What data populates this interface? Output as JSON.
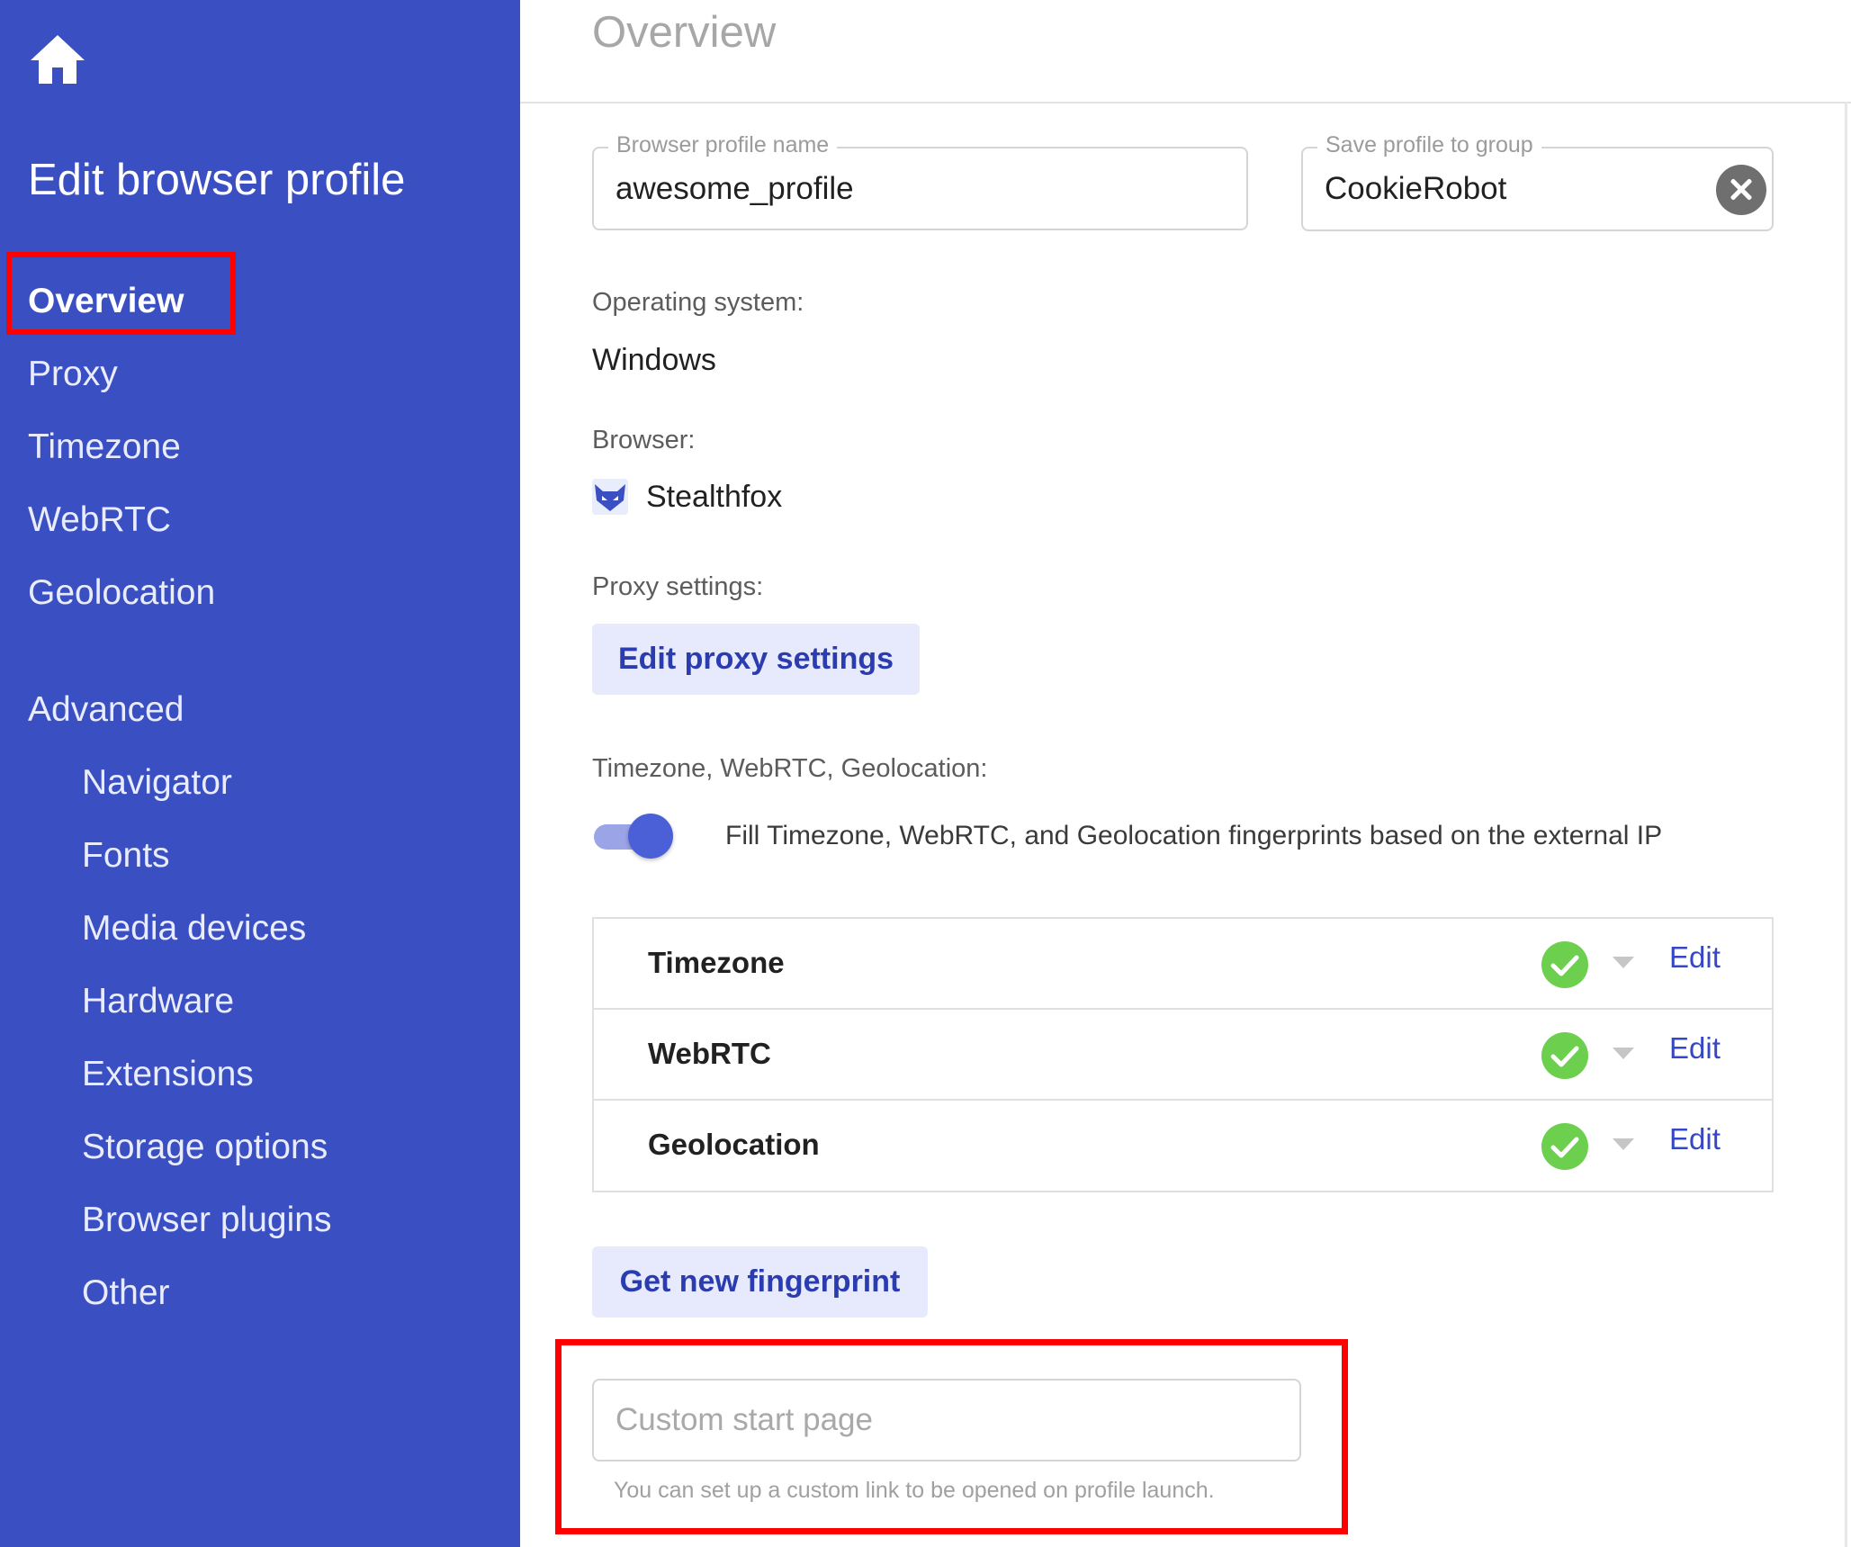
{
  "sidebar": {
    "title": "Edit browser profile",
    "home_icon": "home-icon",
    "items": [
      {
        "label": "Overview",
        "active": true
      },
      {
        "label": "Proxy"
      },
      {
        "label": "Timezone"
      },
      {
        "label": "WebRTC"
      },
      {
        "label": "Geolocation"
      }
    ],
    "advanced_label": "Advanced",
    "advanced_items": [
      {
        "label": "Navigator"
      },
      {
        "label": "Fonts"
      },
      {
        "label": "Media devices"
      },
      {
        "label": "Hardware"
      },
      {
        "label": "Extensions"
      },
      {
        "label": "Storage options"
      },
      {
        "label": "Browser plugins"
      },
      {
        "label": "Other"
      }
    ],
    "background_color": "#3a4fc2"
  },
  "main": {
    "page_title": "Overview",
    "profile_name": {
      "label": "Browser profile name",
      "value": "awesome_profile"
    },
    "group": {
      "label": "Save profile to group",
      "value": "CookieRobot",
      "clear_icon": "close-circle-icon"
    },
    "os": {
      "label": "Operating system:",
      "value": "Windows"
    },
    "browser": {
      "label": "Browser:",
      "value": "Stealthfox",
      "icon": "fox-icon"
    },
    "proxy": {
      "label": "Proxy settings:",
      "button": "Edit proxy settings"
    },
    "auto_fill": {
      "label": "Timezone, WebRTC, Geolocation:",
      "toggle_on": true,
      "text": "Fill Timezone, WebRTC, and Geolocation fingerprints based on the external IP"
    },
    "fingerprint_rows": [
      {
        "label": "Timezone",
        "status_icon": "check-circle-icon",
        "action": "Edit"
      },
      {
        "label": "WebRTC",
        "status_icon": "check-circle-icon",
        "action": "Edit"
      },
      {
        "label": "Geolocation",
        "status_icon": "check-circle-icon",
        "action": "Edit"
      }
    ],
    "new_fingerprint_button": "Get new fingerprint",
    "start_page": {
      "placeholder": "Custom start page",
      "value": "",
      "helper": "You can set up a custom link to be opened on profile launch."
    },
    "accent_color": "#3547c4",
    "status_color": "#6ccf4e",
    "highlight_color": "#ff0000"
  }
}
